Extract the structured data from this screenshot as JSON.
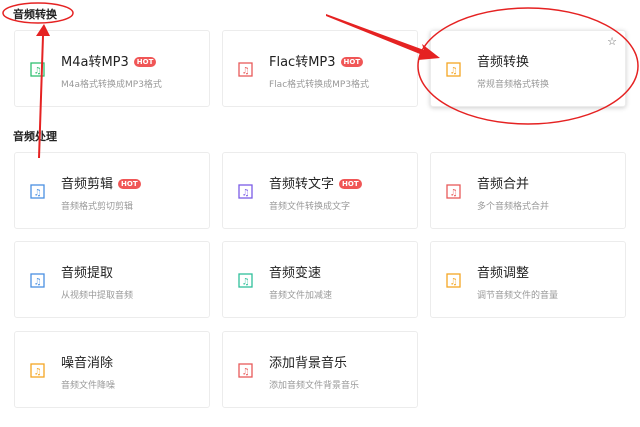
{
  "sections": [
    {
      "title": "音频转换",
      "cards": [
        {
          "title": "M4a转MP3",
          "hot": "HOT",
          "desc": "M4a格式转换成MP3格式",
          "icon": "m4a-to-mp3-icon",
          "color": "#2fbf71"
        },
        {
          "title": "Flac转MP3",
          "hot": "HOT",
          "desc": "Flac格式转换成MP3格式",
          "icon": "flac-to-mp3-icon",
          "color": "#e85a5a"
        },
        {
          "title": "音频转换",
          "desc": "常规音频格式转换",
          "icon": "audio-convert-icon",
          "color": "#f5a623",
          "star": "☆"
        }
      ]
    },
    {
      "title": "音频处理",
      "cards": [
        {
          "title": "音频剪辑",
          "hot": "HOT",
          "desc": "音频格式剪切剪辑",
          "icon": "audio-cut-icon",
          "color": "#4a90e2"
        },
        {
          "title": "音频转文字",
          "hot": "HOT",
          "desc": "音频文件转换成文字",
          "icon": "audio-to-text-icon",
          "color": "#7b5ce6"
        },
        {
          "title": "音频合并",
          "desc": "多个音频格式合并",
          "icon": "audio-merge-icon",
          "color": "#e85a5a"
        },
        {
          "title": "音频提取",
          "desc": "从视频中提取音频",
          "icon": "audio-extract-icon",
          "color": "#4a90e2"
        },
        {
          "title": "音频变速",
          "desc": "音频文件加减速",
          "icon": "audio-speed-icon",
          "color": "#2fbf9b"
        },
        {
          "title": "音频调整",
          "desc": "调节音频文件的音量",
          "icon": "volume-icon",
          "color": "#f5a623"
        },
        {
          "title": "噪音消除",
          "desc": "音频文件降噪",
          "icon": "noise-reduction-icon",
          "color": "#f5a623"
        },
        {
          "title": "添加背景音乐",
          "desc": "添加音频文件背景音乐",
          "icon": "background-music-icon",
          "color": "#e85a5a"
        }
      ]
    }
  ]
}
